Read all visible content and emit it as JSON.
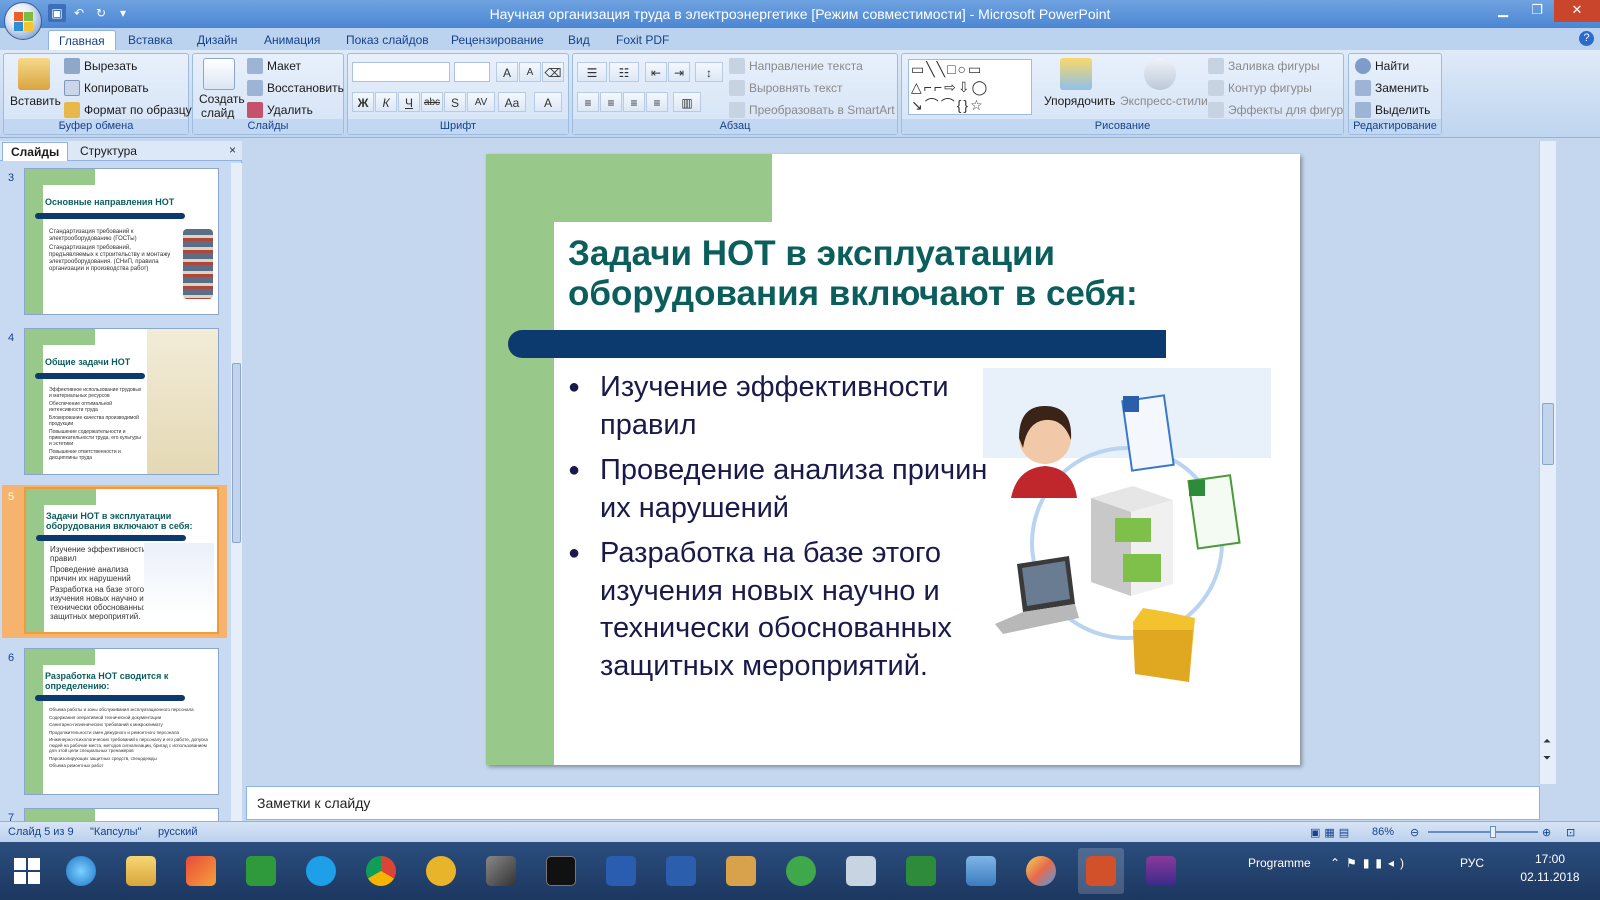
{
  "window": {
    "title": "Научная организация труда в электроэнергетике [Режим совместимости] - Microsoft PowerPoint",
    "minimize": "▁",
    "restore": "❐",
    "close": "✕"
  },
  "tabs": [
    "Главная",
    "Вставка",
    "Дизайн",
    "Анимация",
    "Показ слайдов",
    "Рецензирование",
    "Вид",
    "Foxit PDF"
  ],
  "ribbon": {
    "clipboard": {
      "paste": "Вставить",
      "cut": "Вырезать",
      "copy": "Копировать",
      "format_painter": "Формат по образцу",
      "label": "Буфер обмена"
    },
    "slides": {
      "new_slide": "Создать",
      "new_slide2": "слайд",
      "layout": "Макет",
      "reset": "Восстановить",
      "delete": "Удалить",
      "label": "Слайды"
    },
    "font": {
      "label": "Шрифт",
      "bold": "Ж",
      "italic": "К",
      "underline": "Ч",
      "strike": "abc",
      "shadow": "S",
      "spacing": "AV",
      "case": "Aa",
      "color": "A",
      "grow": "A",
      "shrink": "A"
    },
    "paragraph": {
      "text_direction": "Направление текста",
      "align_text": "Выровнять текст",
      "smartart": "Преобразовать в SmartArt",
      "label": "Абзац"
    },
    "drawing": {
      "arrange": "Упорядочить",
      "quick_styles": "Экспресс-стили",
      "fill": "Заливка фигуры",
      "outline": "Контур фигуры",
      "effects": "Эффекты для фигур",
      "label": "Рисование"
    },
    "editing": {
      "find": "Найти",
      "replace": "Заменить",
      "select": "Выделить",
      "label": "Редактирование"
    }
  },
  "panel": {
    "tab_slides": "Слайды",
    "tab_outline": "Структура",
    "close": "×",
    "thumbs": [
      {
        "num": "3",
        "title": "Основные направления НОТ",
        "bullets": [
          "Стандартизация требований к электрооборудованию (ГОСТы)",
          "Стандартизация требований, предъявляемых к строительству и монтажу электрооборудования. (СНиП, правила организации и производства работ)"
        ]
      },
      {
        "num": "4",
        "title": "Общие задачи НОТ",
        "bullets": [
          "Эффективное использование трудовых и материальных ресурсов",
          "Обеспечение оптимальной интенсивности труда",
          "Блокирование качества производимой продукции",
          "Повышение содержательности и привлекательности труда, его культуры и эстетики",
          "Повышение ответственности и дисциплины труда"
        ]
      },
      {
        "num": "5",
        "title": "Задачи НОТ в эксплуатации оборудования включают в себя:",
        "bullets": [
          "Изучение эффективности правил",
          "Проведение анализа причин их нарушений",
          "Разработка на базе этого изучения новых научно и технически обоснованных защитных мероприятий."
        ]
      },
      {
        "num": "6",
        "title": "Разработка НОТ сводится к определению:",
        "bullets": [
          "Объема работы и зоны обслуживания эксплуатационного персонала",
          "Содержания оперативной технической документации",
          "Санитарно-гигиенических требований к микроклимату",
          "Продолжительности смен дежурного и ремонтного персонала",
          "Инженерно-психологических требований к персоналу и его работе, допуска людей на рабочие места, методов сигнализации, бригад с использованием для этой цели специальных тренажеров",
          "Пароизолирующих защитных средств, спецодежды",
          "Объема ремонтных работ"
        ]
      },
      {
        "num": "7"
      }
    ]
  },
  "slide": {
    "title": "Задачи НОТ в эксплуатации оборудования включают в себя:",
    "bullets": [
      "Изучение эффективности правил",
      "Проведение анализа причин их нарушений",
      "Разработка на базе этого изучения новых научно и технически обоснованных защитных мероприятий."
    ]
  },
  "notes": "Заметки к слайду",
  "status": {
    "slide": "Слайд 5 из 9",
    "theme": "\"Капсулы\"",
    "lang": "русский",
    "zoom": "86%"
  },
  "taskbar": {
    "programme": "Programme",
    "lang": "РУС",
    "time": "17:00",
    "date": "02.11.2018"
  }
}
